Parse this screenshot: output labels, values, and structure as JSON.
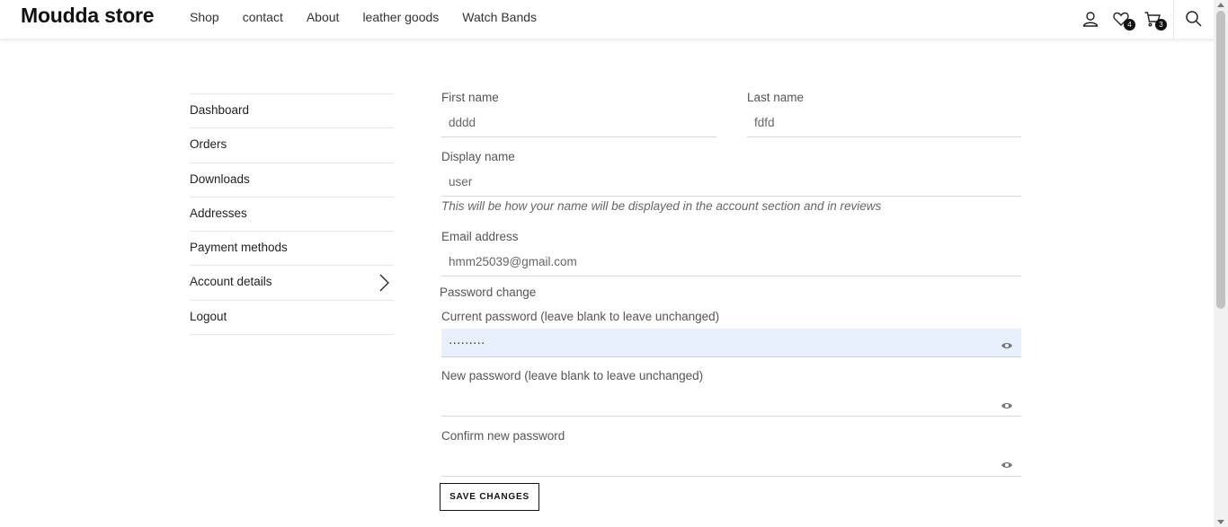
{
  "header": {
    "logo": "Moudda store",
    "nav": [
      "Shop",
      "contact",
      "About",
      "leather goods",
      "Watch Bands"
    ],
    "wishlist_count": "4",
    "cart_count": "3"
  },
  "sidebar": {
    "items": [
      {
        "label": "Dashboard"
      },
      {
        "label": "Orders"
      },
      {
        "label": "Downloads"
      },
      {
        "label": "Addresses"
      },
      {
        "label": "Payment methods"
      },
      {
        "label": "Account details",
        "active": true
      },
      {
        "label": "Logout"
      }
    ]
  },
  "form": {
    "first_name_label": "First name",
    "first_name_value": "dddd",
    "last_name_label": "Last name",
    "last_name_value": "fdfd",
    "display_name_label": "Display name",
    "display_name_value": "user",
    "display_name_hint": "This will be how your name will be displayed in the account section and in reviews",
    "email_label": "Email address",
    "email_value": "hmm25039@gmail.com",
    "password_section_title": "Password change",
    "current_password_label": "Current password (leave blank to leave unchanged)",
    "current_password_value": "·········",
    "new_password_label": "New password (leave blank to leave unchanged)",
    "new_password_value": "",
    "confirm_password_label": "Confirm new password",
    "confirm_password_value": "",
    "save_label": "SAVE CHANGES"
  }
}
